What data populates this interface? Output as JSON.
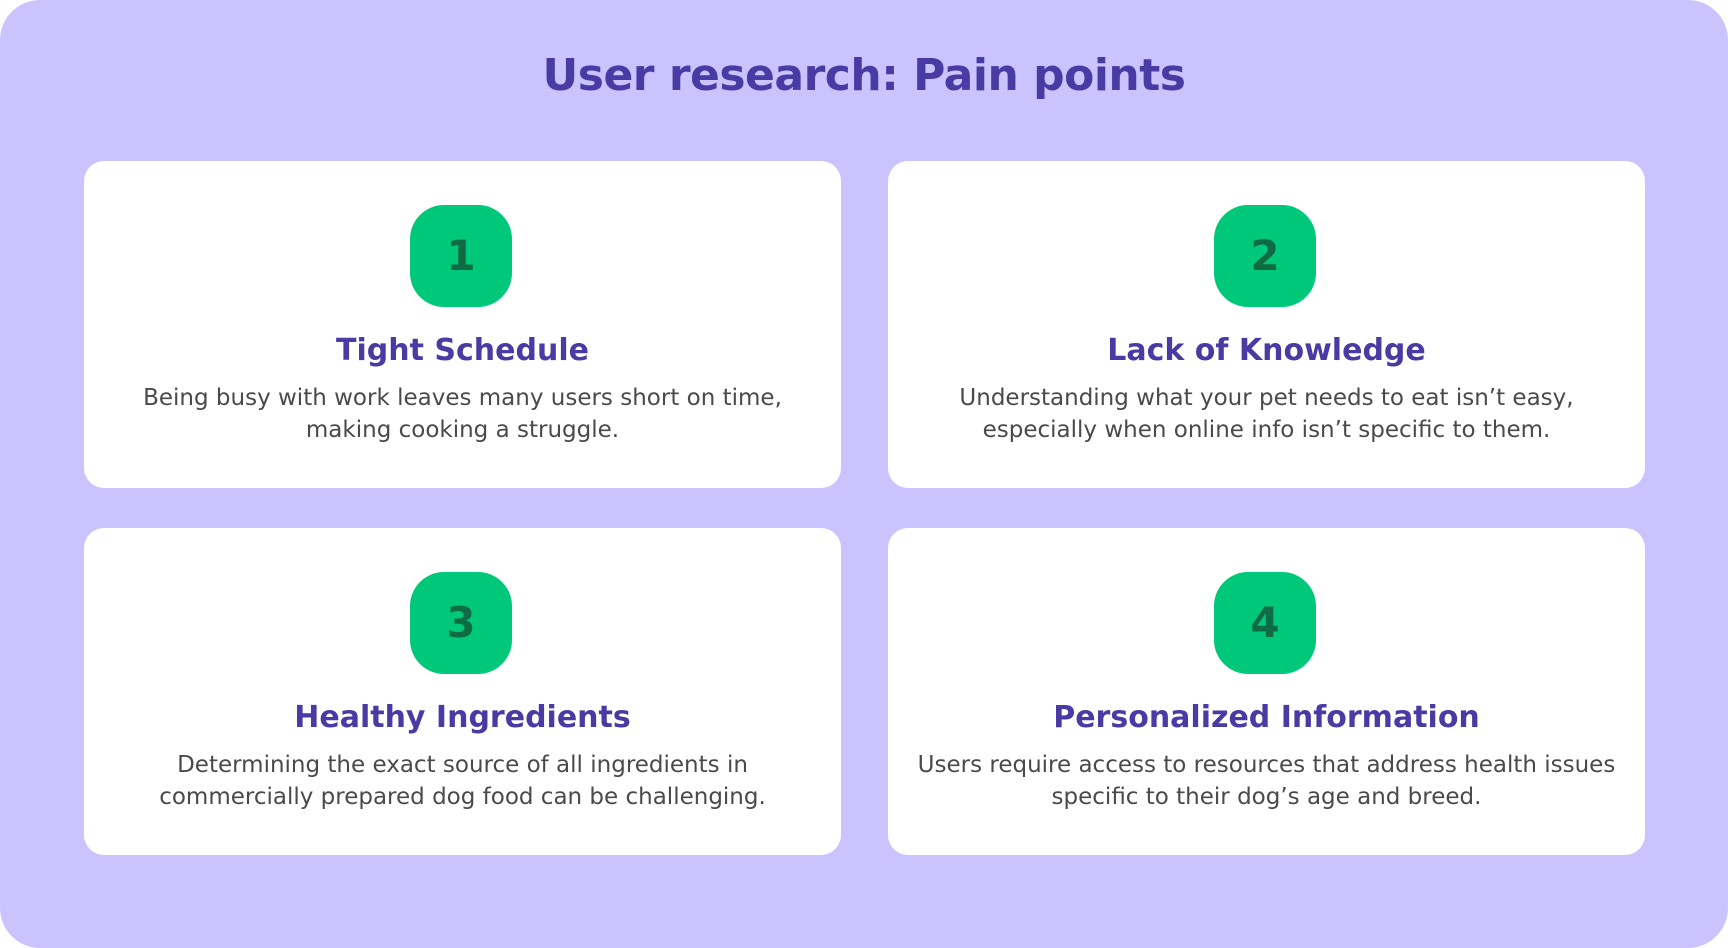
{
  "page": {
    "title": "User research: Pain points"
  },
  "colors": {
    "background": "#cbc3fe",
    "card": "#ffffff",
    "accent_text": "#4a3aa3",
    "badge": "#00c87a",
    "badge_text": "#0f6b45",
    "body_text": "#4a4a4a"
  },
  "cards": [
    {
      "number": "1",
      "title": "Tight Schedule",
      "text": "Being busy with work leaves many users short on time, making cooking a struggle."
    },
    {
      "number": "2",
      "title": "Lack of Knowledge",
      "text": "Understanding what your pet needs to eat isn’t easy, especially when online info isn’t specific to them."
    },
    {
      "number": "3",
      "title": "Healthy Ingredients",
      "text": "Determining the exact source of all ingredients in commercially prepared dog food can be challenging."
    },
    {
      "number": "4",
      "title": "Personalized Information",
      "text": "Users require access to resources that address health issues specific to their dog’s age and breed."
    }
  ]
}
